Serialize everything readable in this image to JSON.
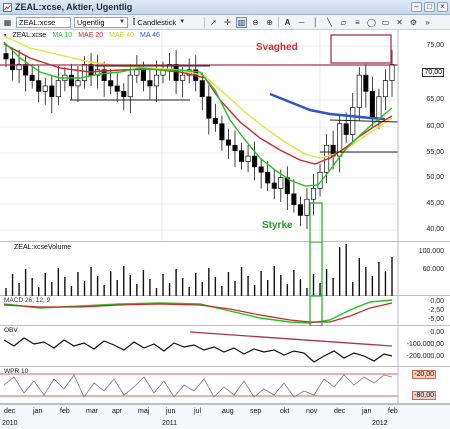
{
  "window": {
    "title": "ZEAL:xcse, Aktier, Ugentlig"
  },
  "toolbar": {
    "symbol": "ZEAL:xcse",
    "period": "Ugentlig",
    "chart_type": "Candlestick"
  },
  "price_pane": {
    "legend": {
      "symbol": "ZEAL:xcse",
      "ma10": "MA 10",
      "mae20": "MAE 20",
      "mae40": "MAE 40",
      "ma46": "MA 46"
    },
    "annotation_weak": "Svaghed",
    "annotation_strong": "Styrke",
    "axis": [
      "75,00",
      "65,00",
      "60,00",
      "55,00",
      "50,00",
      "45,00",
      "40,00"
    ],
    "last_price": "70,00",
    "colors": {
      "up": "#ffffff",
      "down": "#000000",
      "ma10": "#22c322",
      "mae20": "#c72a2a",
      "mae40": "#eaea3b",
      "ma46": "#2a55c9"
    }
  },
  "volume_pane": {
    "label": "ZEAL:xcseVolume",
    "axis": [
      "100.000",
      "60.000"
    ]
  },
  "macd_pane": {
    "label": "MACD 26; 12; 9",
    "axis": [
      "0,00",
      "-2,50",
      "-5,00"
    ]
  },
  "obv_pane": {
    "label": "OBV",
    "axis": [
      "0,00",
      "-100.000,00",
      "-200.000,00"
    ]
  },
  "wpr_pane": {
    "label": "WPR 10",
    "axis": [
      "-20,00",
      "-80,00"
    ]
  },
  "x_axis": {
    "months": [
      "dec",
      "jan",
      "feb",
      "mar",
      "apr",
      "maj",
      "jun",
      "jul",
      "aug",
      "sep",
      "okt",
      "nov",
      "dec",
      "jan",
      "feb"
    ],
    "years": [
      "2010",
      "2011",
      "2012"
    ]
  },
  "chart_data": {
    "type": "candlestick",
    "interval": "weekly",
    "period": "dec 2010 – feb 2012",
    "y_range": [
      40,
      78
    ],
    "closes": [
      73,
      71,
      72,
      70,
      69,
      67,
      68,
      66,
      69,
      70,
      68,
      69,
      72,
      70,
      71,
      69,
      68,
      67,
      66,
      70,
      71,
      69,
      68,
      70,
      71,
      72,
      69,
      70,
      71,
      69,
      66,
      62,
      61,
      58,
      57,
      56,
      54,
      55,
      53,
      52,
      50,
      49,
      51,
      48,
      46,
      44,
      47,
      49,
      52,
      57,
      55,
      61,
      59,
      64,
      70,
      67,
      62,
      66,
      69,
      72
    ]
  }
}
